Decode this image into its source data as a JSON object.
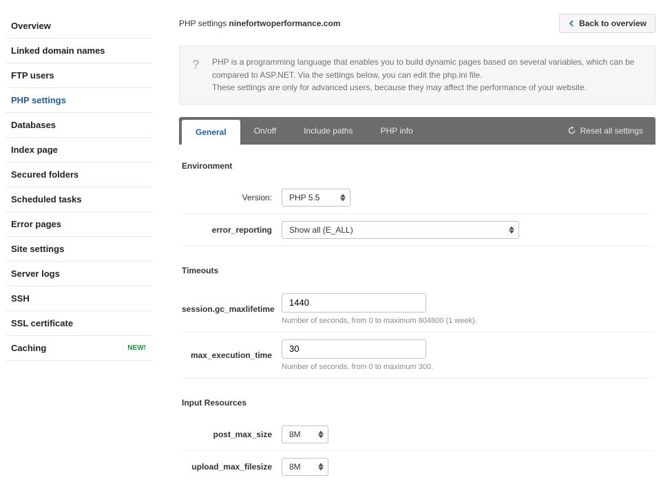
{
  "sidebar": {
    "items": [
      {
        "label": "Overview"
      },
      {
        "label": "Linked domain names"
      },
      {
        "label": "FTP users"
      },
      {
        "label": "PHP settings"
      },
      {
        "label": "Databases"
      },
      {
        "label": "Index page"
      },
      {
        "label": "Secured folders"
      },
      {
        "label": "Scheduled tasks"
      },
      {
        "label": "Error pages"
      },
      {
        "label": "Site settings"
      },
      {
        "label": "Server logs"
      },
      {
        "label": "SSH"
      },
      {
        "label": "SSL certificate"
      },
      {
        "label": "Caching",
        "badge": "NEW!"
      }
    ]
  },
  "header": {
    "title_prefix": "PHP settings",
    "domain": "ninefortwoperformance.com",
    "back_label": "Back to overview"
  },
  "info": {
    "line1": "PHP is a programming language that enables you to build dynamic pages based on several variables, which can be compared to ASP.NET. Via the settings below, you can edit the php.ini file.",
    "line2": "These settings are only for advanced users, because they may affect the performance of your website."
  },
  "tabs": {
    "general": "General",
    "onoff": "On/off",
    "include": "Include paths",
    "phpinfo": "PHP info",
    "reset": "Reset all settings"
  },
  "sections": {
    "environment": {
      "title": "Environment",
      "version_label": "Version:",
      "version_value": "PHP 5.5",
      "error_reporting_label": "error_reporting",
      "error_reporting_value": "Show all (E_ALL)"
    },
    "timeouts": {
      "title": "Timeouts",
      "gc_label": "session.gc_maxlifetime",
      "gc_value": "1440",
      "gc_hint": "Number of seconds, from 0 to maximum 604800 (1 week).",
      "exec_label": "max_execution_time",
      "exec_value": "30",
      "exec_hint": "Number of seconds, from 0 to maximum 300."
    },
    "input": {
      "title": "Input Resources",
      "post_label": "post_max_size",
      "post_value": "8M",
      "upload_label": "upload_max_filesize",
      "upload_value": "8M"
    }
  }
}
